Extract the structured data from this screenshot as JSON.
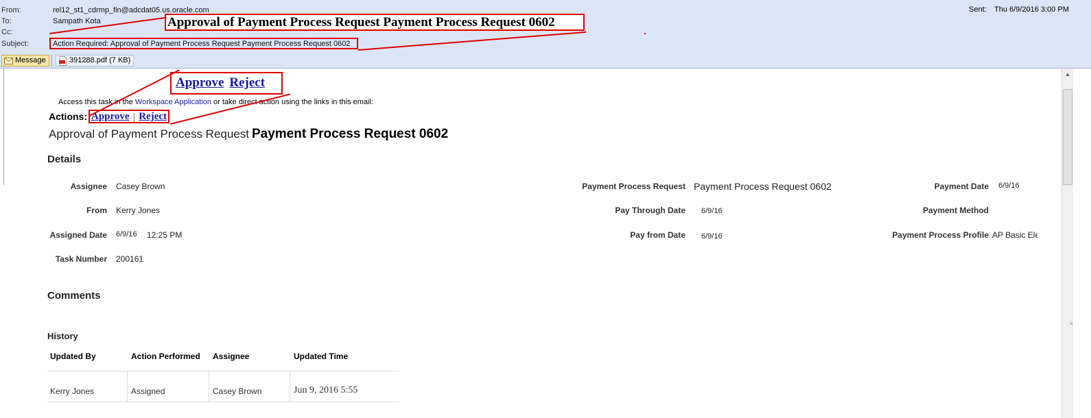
{
  "header": {
    "from_label": "From:",
    "from_value": "rel12_st1_cdrmp_fin@adcdat05.us.oracle.com",
    "to_label": "To:",
    "to_value": "Sampath Kota",
    "cc_label": "Cc:",
    "subject_label": "Subject:",
    "subject_value": "Action Required: Approval of Payment Process Request Payment Process Request  0602",
    "sent_label": "Sent:",
    "sent_value": "Thu 6/9/2016 3:00 PM"
  },
  "callouts": {
    "subject_zoom": "Approval of Payment Process Request Payment Process Request 0602",
    "approve_zoom": "Approve",
    "reject_zoom": "Reject"
  },
  "toolbar": {
    "message_label": "Message",
    "attachment_label": "391288.pdf (7 KB)"
  },
  "body": {
    "access_prefix": "Access this task in the ",
    "access_link": "Workspace Application",
    "access_suffix": " or take direct action using the links in this email:",
    "actions_label": "Actions:",
    "approve_link": "Approve",
    "reject_link": "Reject",
    "separator": "|",
    "title_prefix": "Approval of Payment Process Request",
    "title_name": "Payment Process Request 0602",
    "details_heading": "Details",
    "comments_heading": "Comments",
    "history_heading": "History"
  },
  "details": {
    "assignee_label": "Assignee",
    "assignee_value": "Casey Brown",
    "from_label": "From",
    "from_value": "Kerry Jones",
    "assigned_date_label": "Assigned Date",
    "assigned_date_value": "6/9/16",
    "assigned_time_value": "12:25 PM",
    "task_number_label": "Task Number",
    "task_number_value": "200161",
    "ppr_label": "Payment Process Request",
    "ppr_value": "Payment Process Request 0602",
    "pay_through_label": "Pay Through Date",
    "pay_through_value": "6/9/16",
    "pay_from_label": "Pay from Date",
    "pay_from_value": "6/9/16",
    "payment_date_label": "Payment Date",
    "payment_date_value": "6/9/16",
    "payment_method_label": "Payment Method",
    "profile_label": "Payment Process Profile",
    "profile_value": "AP Basic Ele"
  },
  "history": {
    "columns": [
      "Updated By",
      "Action Performed",
      "Assignee",
      "Updated Time"
    ],
    "rows": [
      [
        "Kerry Jones",
        "Assigned",
        "Casey Brown",
        "Jun 9, 2016 5:55"
      ]
    ]
  },
  "colors": {
    "header_bg": "#dbe5f5",
    "callout_red": "#e00000",
    "link_blue": "#1a1aa6"
  }
}
